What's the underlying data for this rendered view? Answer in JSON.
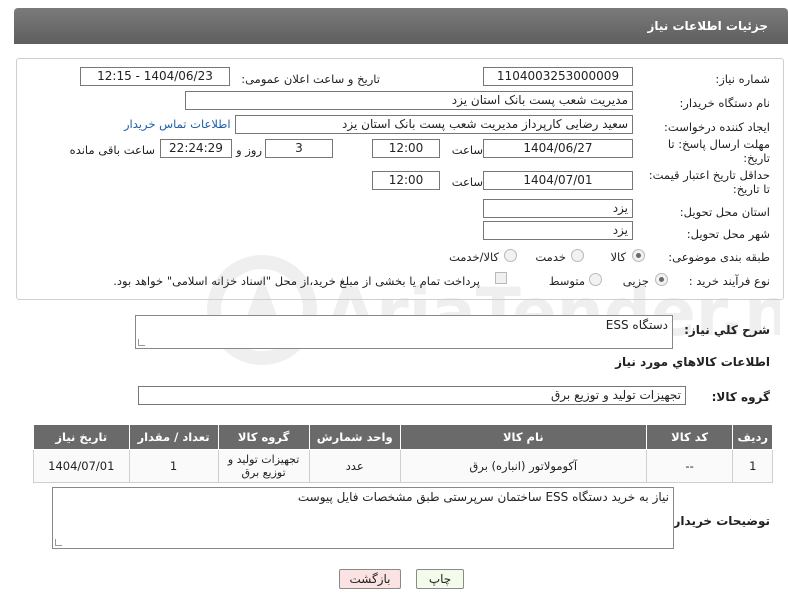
{
  "header": {
    "title": "جزئیات اطلاعات نیاز"
  },
  "form": {
    "need_number_label": "شماره نیاز:",
    "need_number": "1104003253000009",
    "announce_label": "تاریخ و ساعت اعلان عمومی:",
    "announce_value": "1404/06/23 - 12:15",
    "buyer_org_label": "نام دستگاه خریدار:",
    "buyer_org": "مدیریت شعب پست بانک استان یزد",
    "requester_label": "ایجاد کننده درخواست:",
    "requester": "سعید  رضایی کارپرداز مدیریت شعب پست بانک استان یزد",
    "buyer_contact_link": "اطلاعات تماس خریدار",
    "reply_deadline_label_1": "مهلت ارسال پاسخ: تا",
    "reply_deadline_label_2": "تاریخ:",
    "reply_date": "1404/06/27",
    "time_label": "ساعت",
    "reply_time": "12:00",
    "days_value": "3",
    "days_label": "روز و",
    "remaining_time": "22:24:29",
    "remaining_label": "ساعت باقی مانده",
    "price_deadline_label_1": "حداقل تاریخ اعتبار قیمت:",
    "price_deadline_label_2": "تا تاریخ:",
    "price_date": "1404/07/01",
    "price_time": "12:00",
    "province_label": "استان محل تحویل:",
    "province": "یزد",
    "city_label": "شهر محل تحویل:",
    "city": "یزد",
    "category_label": "طبقه بندی موضوعی:",
    "category_options": [
      "کالا",
      "خدمت",
      "کالا/خدمت"
    ],
    "process_label": "نوع فرآیند خرید :",
    "process_options": [
      "جزیی",
      "متوسط"
    ],
    "payment_note": "پرداخت تمام یا بخشی از مبلغ خرید،از محل \"اسناد خزانه اسلامی\" خواهد بود."
  },
  "description": {
    "label": "شرح کلي نياز:",
    "value": "دستگاه ESS"
  },
  "goods_section": {
    "title": "اطلاعات کالاهاي مورد نياز",
    "group_label": "گروه کالا:",
    "group_value": "تجهیزات تولید و توزیع برق"
  },
  "table": {
    "headers": [
      "ردیف",
      "کد کالا",
      "نام کالا",
      "واحد شمارش",
      "گروه کالا",
      "تعداد / مقدار",
      "تاریخ نیاز"
    ],
    "rows": [
      [
        "1",
        "--",
        "آکومولاتور (انباره) برق",
        "عدد",
        "تجهیزات تولید و توزیع برق",
        "1",
        "1404/07/01"
      ]
    ]
  },
  "buyer_notes": {
    "label": "توضیحات خریدار:",
    "value": "نیاز به خرید دستگاه ESS  ساختمان سرپرستی  طبق مشخصات فایل پیوست"
  },
  "buttons": {
    "print": "چاپ",
    "back": "بازگشت"
  },
  "watermark": {
    "text": "AriaTender.neT"
  }
}
